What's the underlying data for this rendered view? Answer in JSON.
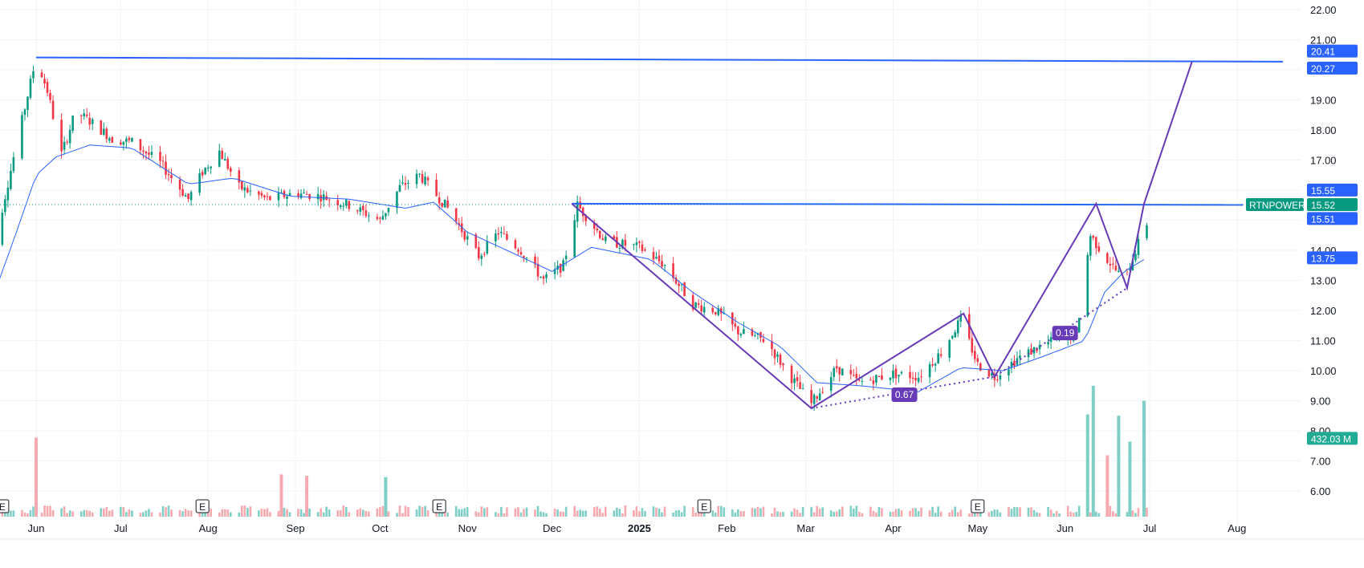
{
  "chart_data": {
    "type": "candlestick",
    "symbol": "RTNPOWER",
    "y_ticks": [
      "22.00",
      "21.00",
      "20.00",
      "19.00",
      "18.00",
      "17.00",
      "16.00",
      "15.00",
      "14.00",
      "13.00",
      "12.00",
      "11.00",
      "10.00",
      "9.00",
      "8.00",
      "7.00",
      "6.00"
    ],
    "ylim": [
      5,
      22.2
    ],
    "x_labels": [
      {
        "label": "Jun",
        "date": "2024-06-01",
        "bold": false
      },
      {
        "label": "Jul",
        "date": "2024-07-01",
        "bold": false
      },
      {
        "label": "Aug",
        "date": "2024-08-01",
        "bold": false
      },
      {
        "label": "Sep",
        "date": "2024-09-01",
        "bold": false
      },
      {
        "label": "Oct",
        "date": "2024-10-01",
        "bold": false
      },
      {
        "label": "Nov",
        "date": "2024-11-01",
        "bold": false
      },
      {
        "label": "Dec",
        "date": "2024-12-01",
        "bold": false
      },
      {
        "label": "2025",
        "date": "2025-01-01",
        "bold": true
      },
      {
        "label": "Feb",
        "date": "2025-02-01",
        "bold": false
      },
      {
        "label": "Mar",
        "date": "2025-03-01",
        "bold": false
      },
      {
        "label": "Apr",
        "date": "2025-04-01",
        "bold": false
      },
      {
        "label": "May",
        "date": "2025-05-01",
        "bold": false
      },
      {
        "label": "Jun",
        "date": "2025-06-01",
        "bold": false
      },
      {
        "label": "Jul",
        "date": "2025-07-01",
        "bold": false
      },
      {
        "label": "Aug",
        "date": "2025-08-01",
        "bold": false
      }
    ],
    "price_path": [
      [
        "2024-05-15",
        13.4
      ],
      [
        "2024-05-20",
        15.4
      ],
      [
        "2024-05-25",
        17.5
      ],
      [
        "2024-06-01",
        20.4
      ],
      [
        "2024-06-05",
        19.3
      ],
      [
        "2024-06-10",
        17.2
      ],
      [
        "2024-06-15",
        18.6
      ],
      [
        "2024-06-20",
        18.3
      ],
      [
        "2024-06-28",
        17.7
      ],
      [
        "2024-07-05",
        17.6
      ],
      [
        "2024-07-15",
        16.9
      ],
      [
        "2024-07-25",
        15.7
      ],
      [
        "2024-07-30",
        16.6
      ],
      [
        "2024-08-05",
        17.3
      ],
      [
        "2024-08-12",
        16.1
      ],
      [
        "2024-08-22",
        15.7
      ],
      [
        "2024-09-01",
        15.9
      ],
      [
        "2024-09-10",
        15.8
      ],
      [
        "2024-09-20",
        15.5
      ],
      [
        "2024-10-01",
        15.0
      ],
      [
        "2024-10-08",
        16.1
      ],
      [
        "2024-10-15",
        16.5
      ],
      [
        "2024-10-25",
        15.4
      ],
      [
        "2024-11-05",
        13.8
      ],
      [
        "2024-11-12",
        14.6
      ],
      [
        "2024-11-20",
        14.0
      ],
      [
        "2024-11-28",
        13.0
      ],
      [
        "2024-12-05",
        13.5
      ],
      [
        "2024-12-10",
        15.5
      ],
      [
        "2024-12-20",
        14.3
      ],
      [
        "2025-01-01",
        14.1
      ],
      [
        "2025-01-10",
        13.5
      ],
      [
        "2025-01-20",
        12.2
      ],
      [
        "2025-01-28",
        12.0
      ],
      [
        "2025-02-05",
        11.3
      ],
      [
        "2025-02-15",
        11.0
      ],
      [
        "2025-02-22",
        10.0
      ],
      [
        "2025-03-03",
        8.9
      ],
      [
        "2025-03-12",
        10.1
      ],
      [
        "2025-03-20",
        9.6
      ],
      [
        "2025-04-01",
        9.9
      ],
      [
        "2025-04-10",
        9.8
      ],
      [
        "2025-04-18",
        10.6
      ],
      [
        "2025-04-25",
        11.7
      ],
      [
        "2025-05-01",
        10.2
      ],
      [
        "2025-05-07",
        9.8
      ],
      [
        "2025-05-15",
        10.4
      ],
      [
        "2025-05-25",
        10.9
      ],
      [
        "2025-06-05",
        11.2
      ],
      [
        "2025-06-10",
        14.5
      ],
      [
        "2025-06-15",
        13.8
      ],
      [
        "2025-06-22",
        13.0
      ],
      [
        "2025-06-26",
        14.0
      ],
      [
        "2025-06-30",
        14.9
      ]
    ],
    "ma_path": [
      [
        "2024-05-15",
        12.0
      ],
      [
        "2024-05-25",
        14.6
      ],
      [
        "2024-06-01",
        16.5
      ],
      [
        "2024-06-08",
        17.1
      ],
      [
        "2024-06-20",
        17.5
      ],
      [
        "2024-07-05",
        17.4
      ],
      [
        "2024-07-25",
        16.2
      ],
      [
        "2024-08-10",
        16.4
      ],
      [
        "2024-08-30",
        15.8
      ],
      [
        "2024-09-20",
        15.7
      ],
      [
        "2024-10-10",
        15.4
      ],
      [
        "2024-10-20",
        15.6
      ],
      [
        "2024-11-01",
        14.6
      ],
      [
        "2024-11-15",
        14.0
      ],
      [
        "2024-12-01",
        13.3
      ],
      [
        "2024-12-15",
        14.1
      ],
      [
        "2025-01-05",
        13.7
      ],
      [
        "2025-01-20",
        12.6
      ],
      [
        "2025-02-05",
        11.6
      ],
      [
        "2025-02-20",
        10.8
      ],
      [
        "2025-03-05",
        9.6
      ],
      [
        "2025-03-20",
        9.5
      ],
      [
        "2025-04-10",
        9.3
      ],
      [
        "2025-04-25",
        10.1
      ],
      [
        "2025-05-10",
        10.0
      ],
      [
        "2025-05-25",
        10.5
      ],
      [
        "2025-06-08",
        11.0
      ],
      [
        "2025-06-15",
        12.6
      ],
      [
        "2025-06-22",
        13.3
      ],
      [
        "2025-06-30",
        13.75
      ]
    ],
    "volume_bars": [
      {
        "date": "2025-06-09",
        "height": 0.75,
        "up": true
      },
      {
        "date": "2025-06-11",
        "height": 0.96,
        "up": true
      },
      {
        "date": "2025-06-16",
        "height": 0.45,
        "up": false
      },
      {
        "date": "2025-06-20",
        "height": 0.74,
        "up": true
      },
      {
        "date": "2025-06-24",
        "height": 0.55,
        "up": true
      },
      {
        "date": "2025-06-29",
        "height": 0.85,
        "up": true
      },
      {
        "date": "2024-06-01",
        "height": 0.58,
        "up": false
      },
      {
        "date": "2024-05-15",
        "height": 0.9,
        "up": false
      },
      {
        "date": "2024-10-03",
        "height": 0.29,
        "up": true
      },
      {
        "date": "2024-09-05",
        "height": 0.3,
        "up": false
      },
      {
        "date": "2024-08-27",
        "height": 0.31,
        "up": false
      }
    ],
    "horizontal_lines": [
      {
        "name": "upper-resistance",
        "value": 20.41,
        "end": 20.27
      },
      {
        "name": "neckline",
        "value": 15.55,
        "end": 15.51
      }
    ],
    "last_price": 15.52,
    "zigzag": [
      [
        "2024-12-08",
        15.55
      ],
      [
        "2025-03-03",
        8.75
      ],
      [
        "2025-04-26",
        11.9
      ],
      [
        "2025-05-07",
        9.8
      ],
      [
        "2025-06-12",
        15.55
      ],
      [
        "2025-06-23",
        12.75
      ],
      [
        "2025-06-29",
        15.55
      ],
      [
        "2025-07-16",
        20.27
      ]
    ],
    "dotted_trend": [
      [
        "2025-03-03",
        8.75
      ],
      [
        "2025-05-07",
        9.8
      ],
      [
        "2025-06-23",
        12.75
      ]
    ],
    "price_labels": [
      {
        "text": "20.41",
        "value": 20.41,
        "color": "#2962ff"
      },
      {
        "text": "20.27",
        "value": 20.27,
        "color": "#2962ff"
      },
      {
        "text": "15.55",
        "value": 15.55,
        "color": "#2962ff"
      },
      {
        "text": "15.52",
        "value": 15.52,
        "color": "#089981"
      },
      {
        "text": "15.51",
        "value": 15.51,
        "color": "#2962ff"
      },
      {
        "text": "13.75",
        "value": 13.75,
        "color": "#2962ff"
      },
      {
        "text": "432.03 M",
        "value": 7.75,
        "color": "#22ab94"
      }
    ],
    "annotations": [
      {
        "text": "0.67",
        "date": "2025-04-05",
        "value": 9.2
      },
      {
        "text": "0.19",
        "date": "2025-06-01",
        "value": 11.25
      }
    ],
    "earnings_markers": [
      "2024-05-20",
      "2024-07-30",
      "2024-10-22",
      "2025-01-24",
      "2025-05-01"
    ],
    "earnings_label": "E",
    "grid": true,
    "colors": {
      "up": "#089981",
      "down": "#f23645",
      "ma": "#2962ff",
      "zigzag": "#673ab7",
      "hline": "#2962ff",
      "vol_up": "#7ed0c6",
      "vol_down": "#f6a9ae"
    }
  }
}
